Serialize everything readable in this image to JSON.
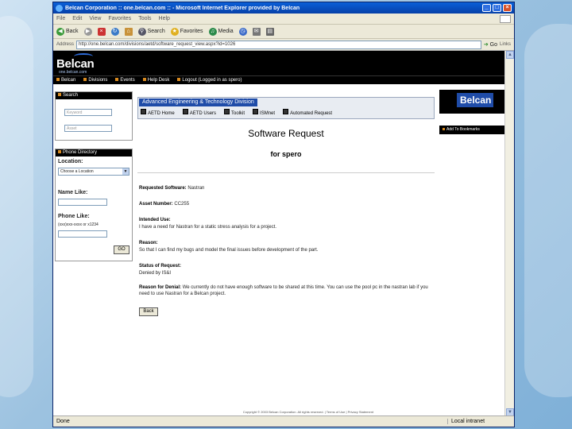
{
  "browser": {
    "title": "Belcan Corporation :: one.belcan.com :: - Microsoft Internet Explorer provided by Belcan",
    "menu": [
      "File",
      "Edit",
      "View",
      "Favorites",
      "Tools",
      "Help"
    ],
    "toolbar": {
      "back": "Back",
      "search": "Search",
      "favorites": "Favorites",
      "media": "Media"
    },
    "address_label": "Address",
    "address_value": "http://one.belcan.com/divisions/aetd/software_request_view.aspx?id=1026",
    "go": "Go",
    "links_label": "Links",
    "status_done": "Done",
    "status_zone": "Local intranet"
  },
  "site": {
    "logo": "Belcan",
    "logo_sub": "one.belcan.com",
    "nav": [
      "Belcan",
      "Divisions",
      "Events",
      "Help Desk",
      "Logout (Logged in as spero)"
    ]
  },
  "left": {
    "search_head": "Search",
    "search_fields": [
      "Keyword",
      "Asset"
    ],
    "directory_head": "Phone Directory",
    "location_label": "Location:",
    "location_value": "Choose a Location",
    "name_label": "Name Like:",
    "phone_label": "Phone Like:",
    "phone_hint": "(xxx)xxx-xxxx or x1234",
    "go_button": "GO"
  },
  "banner": {
    "title": "Advanced Engineering & Technology Division",
    "tabs": [
      "AETD Home",
      "AETD Users",
      "Toolkit",
      "ISMnet",
      "Automated Request"
    ]
  },
  "right": {
    "logo": "Belcan",
    "favorites": "Add To Bookmarks"
  },
  "request": {
    "title": "Software Request",
    "subtitle": "for spero",
    "requested_label": "Requested Software:",
    "requested_value": "Nastran",
    "asset_label": "Asset Number:",
    "asset_value": "CC255",
    "intended_label": "Intended Use:",
    "intended_value": "I have a need for Nastran for a static stress analysis for a project.",
    "reason_label": "Reason:",
    "reason_value": "So that I can find my bugs and model the final issues before development of the part.",
    "status_label": "Status of Request:",
    "status_value": "Denied by IS&I",
    "denial_label": "Reason for Denial:",
    "denial_value": "We currently do not have enough software to be shared at this time. You can use the pool pc in the nastran lab if you need to use Nastran for a Belcan project.",
    "back_button": "Back"
  },
  "footer": "Copyright © 2003 Belcan Corporation. All rights reserved. | Terms of Use | Privacy Statement"
}
